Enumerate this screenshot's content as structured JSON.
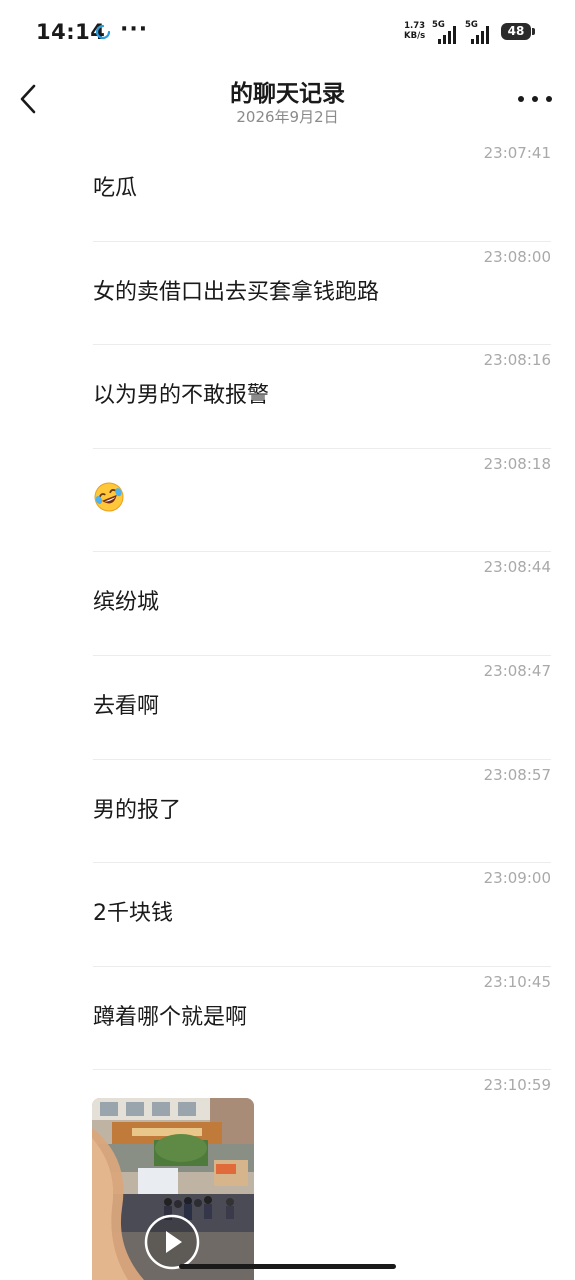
{
  "status_bar": {
    "time": "14:14",
    "dots": "···",
    "speed_value": "1.73",
    "speed_unit": "KB/s",
    "sim1_label": "5G",
    "sim2_label": "5G",
    "battery": "48"
  },
  "header": {
    "title": "的聊天记录",
    "date": "2026年9月2日",
    "back_icon": "chevron-left-icon",
    "more_icon": "more-horizontal-icon"
  },
  "messages": [
    {
      "time": "23:07:41",
      "text": "吃瓜"
    },
    {
      "time": "23:08:00",
      "text": "女的卖借口出去买套拿钱跑路"
    },
    {
      "time": "23:08:16",
      "text": "以为男的不敢报警"
    },
    {
      "time": "23:08:18",
      "text": "",
      "emoji": "laughing-crying-face-icon"
    },
    {
      "time": "23:08:44",
      "text": "缤纷城"
    },
    {
      "time": "23:08:47",
      "text": "去看啊"
    },
    {
      "time": "23:08:57",
      "text": "男的报了"
    },
    {
      "time": "23:09:00",
      "text": "2千块钱"
    },
    {
      "time": "23:10:45",
      "text": "蹲着哪个就是啊"
    },
    {
      "time": "23:10:59",
      "text": "",
      "video": "video-thumbnail",
      "icon": "play-icon"
    }
  ]
}
